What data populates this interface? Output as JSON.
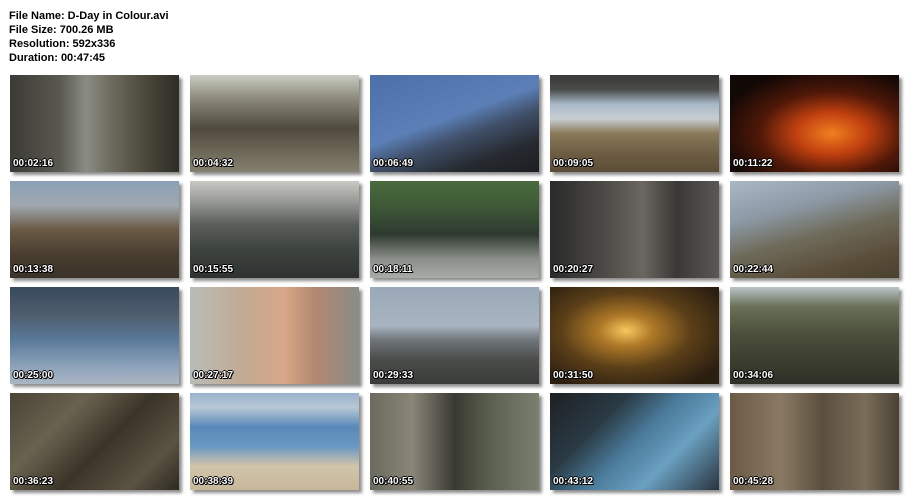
{
  "file_info": {
    "name_line": "File Name: D-Day in Colour.avi",
    "size_line": "File Size: 700.26 MB",
    "resolution_line": "Resolution: 592x336",
    "duration_line": "Duration: 00:47:45"
  },
  "thumbnails": [
    {
      "time": "00:02:16"
    },
    {
      "time": "00:04:32"
    },
    {
      "time": "00:06:49"
    },
    {
      "time": "00:09:05"
    },
    {
      "time": "00:11:22"
    },
    {
      "time": "00:13:38"
    },
    {
      "time": "00:15:55"
    },
    {
      "time": "00:18:11"
    },
    {
      "time": "00:20:27"
    },
    {
      "time": "00:22:44"
    },
    {
      "time": "00:25:00"
    },
    {
      "time": "00:27:17"
    },
    {
      "time": "00:29:33"
    },
    {
      "time": "00:31:50"
    },
    {
      "time": "00:34:06"
    },
    {
      "time": "00:36:23"
    },
    {
      "time": "00:38:39"
    },
    {
      "time": "00:40:55"
    },
    {
      "time": "00:43:12"
    },
    {
      "time": "00:45:28"
    }
  ]
}
